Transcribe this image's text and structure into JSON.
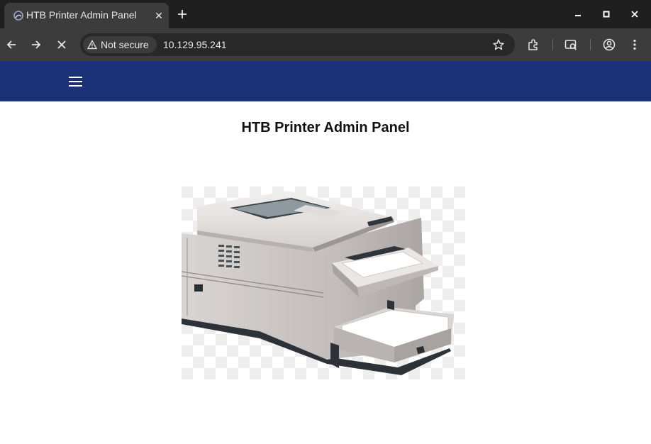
{
  "browser": {
    "tab": {
      "title": "HTB Printer Admin Panel",
      "close_glyph": "✕"
    },
    "new_tab_icon": "plus-icon",
    "window_controls": [
      "minimize-icon",
      "maximize-icon",
      "close-icon"
    ],
    "nav": [
      "back-arrow-icon",
      "forward-arrow-icon",
      "stop-loading-icon"
    ],
    "security_label": "Not secure",
    "url": "10.129.95.241",
    "toolbar_icons": [
      "bookmark-star-icon",
      "extensions-icon",
      "lens-search-icon",
      "profile-icon",
      "menu-kebab-icon"
    ],
    "colors": {
      "tabbar": "#1f1f1f",
      "toolbar": "#3c3c3c",
      "omnibox": "#282828"
    }
  },
  "site": {
    "header_color": "#1b3278",
    "menu_icon": "hamburger-menu-icon",
    "title": "HTB Printer Admin Panel",
    "image": "printer-image"
  }
}
